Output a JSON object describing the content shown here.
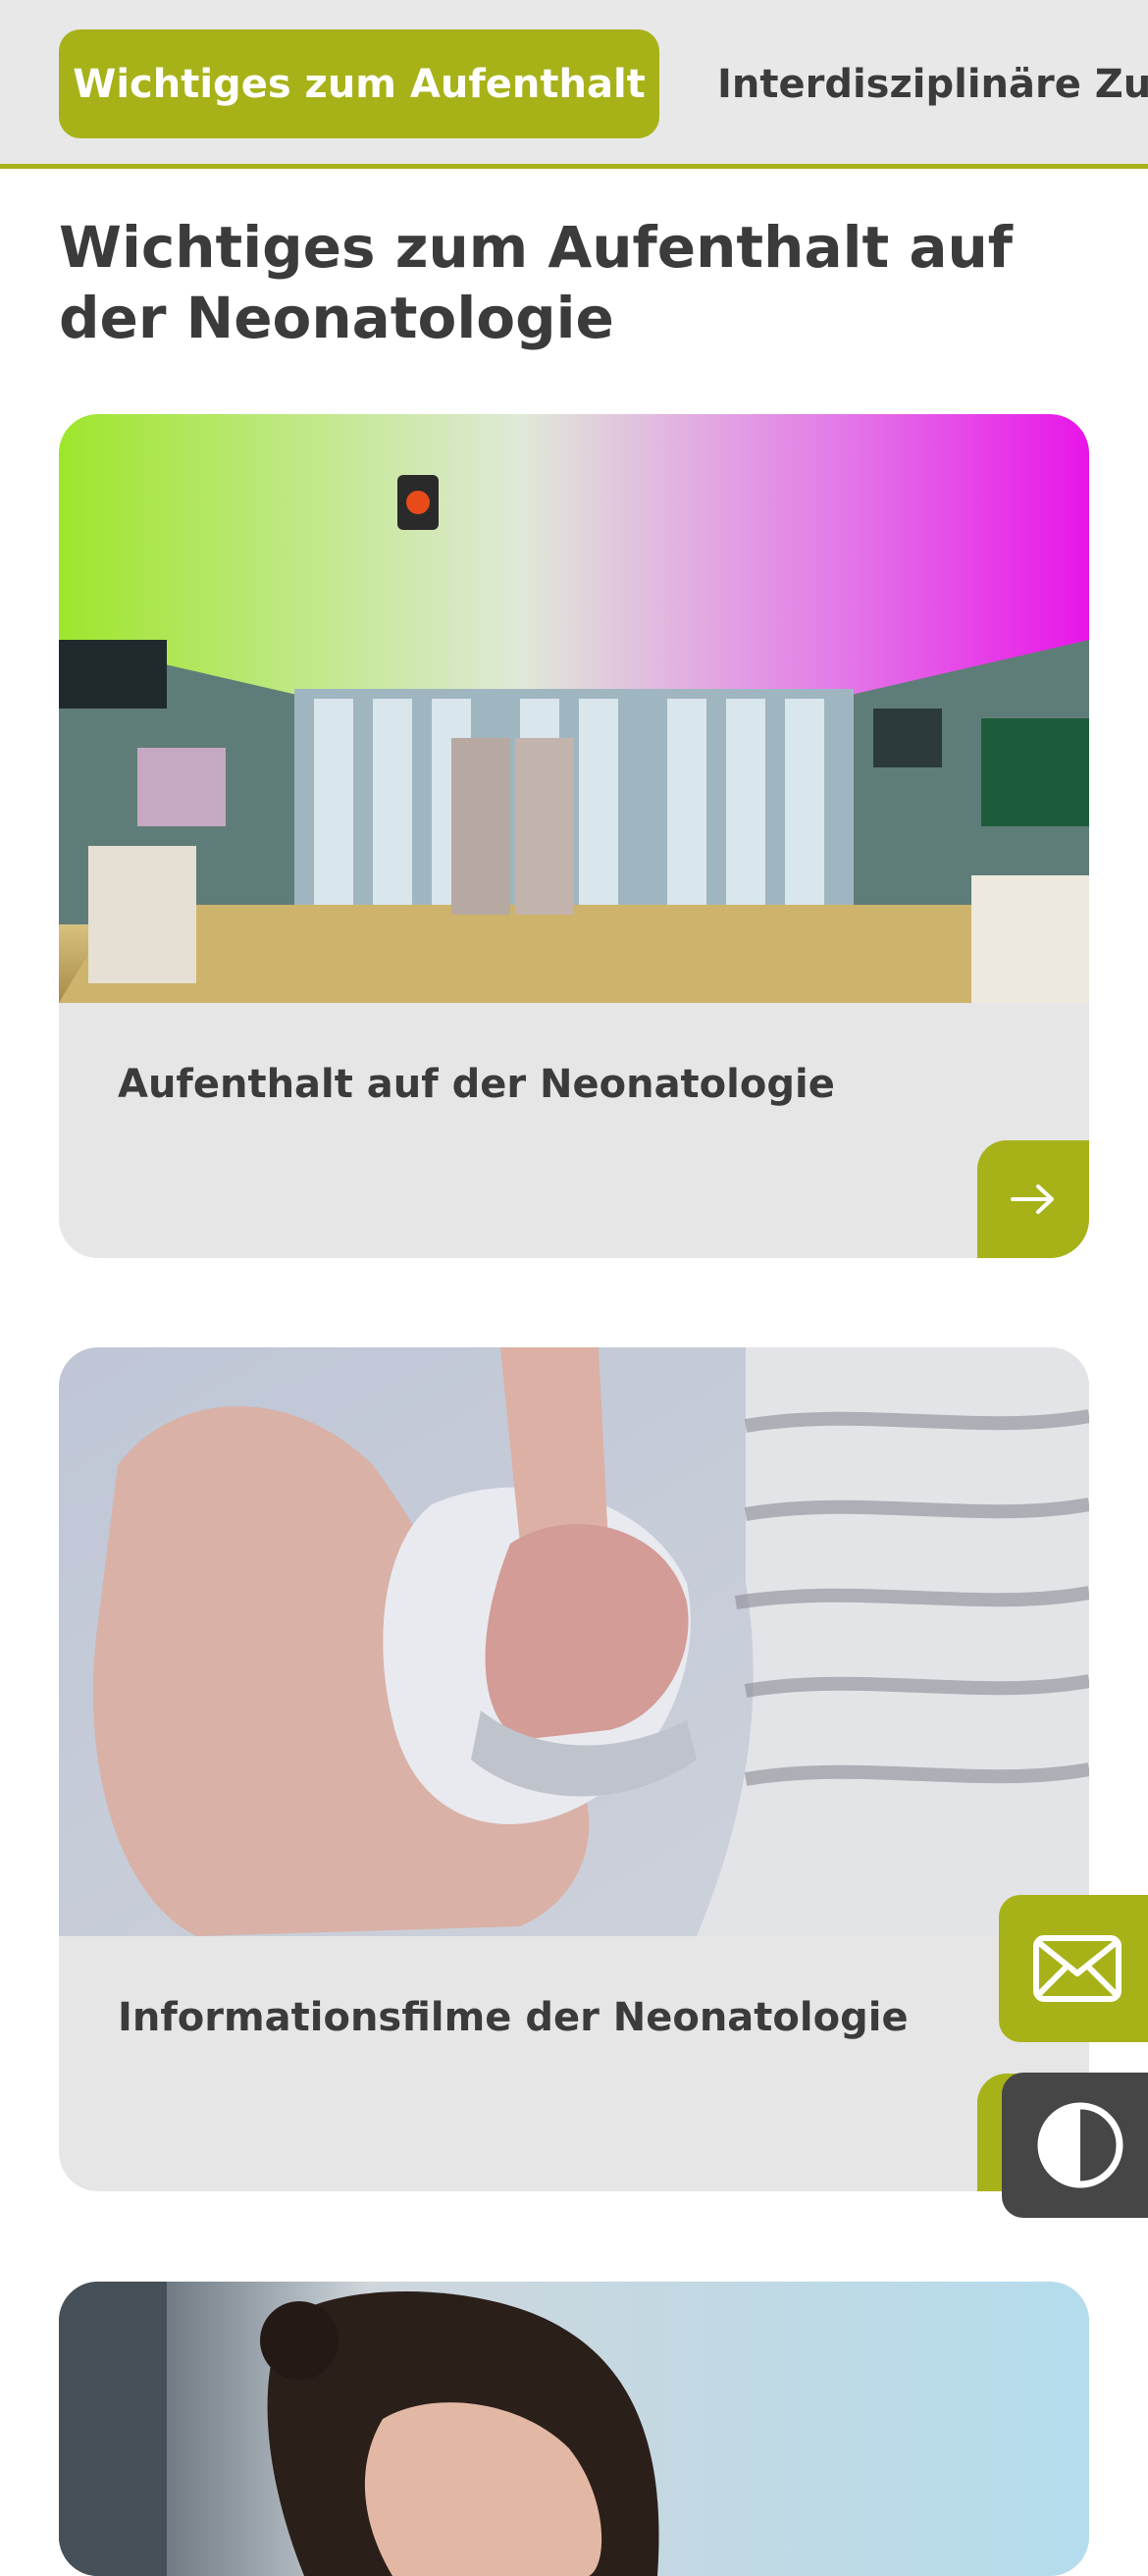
{
  "tabs": [
    {
      "label": "Wichtiges zum Aufenthalt",
      "active": true
    },
    {
      "label": "Interdisziplinäre Zusammenarbeit",
      "active": false
    }
  ],
  "page": {
    "title": "Wichtiges zum Aufenthalt auf der Neonatologie"
  },
  "cards": [
    {
      "title": "Aufenthalt auf der Neonatologie",
      "image": "neonatology-ward-photo",
      "link_icon": "arrow-right-icon"
    },
    {
      "title": "Informationsfilme der Neonatologie",
      "image": "newborn-hand-photo",
      "link_icon": "arrow-right-icon"
    },
    {
      "title": "",
      "image": "mother-photo"
    }
  ],
  "floating": {
    "contact_icon": "mail-icon",
    "contrast_icon": "contrast-icon"
  },
  "colors": {
    "accent": "#a7b219",
    "tabbar_bg": "#e8e8e8",
    "card_bg": "#e6e6e6",
    "text": "#3b3b3b",
    "contrast_button_bg": "#464646"
  }
}
